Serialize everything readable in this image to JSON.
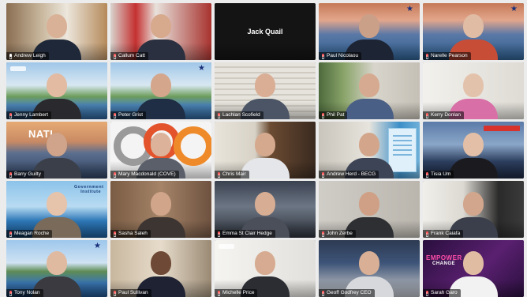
{
  "meeting": {
    "participants": [
      {
        "name": "Andrew Leigh",
        "bg": "bg-office",
        "skin": "#d9b197",
        "shirt": "#1f2838",
        "speaking": true,
        "muted": false
      },
      {
        "name": "Callum Catt",
        "bg": "bg-red",
        "skin": "#d7a98d",
        "shirt": "#2a3040",
        "speaking": false,
        "muted": true
      },
      {
        "name": "Jack Quail",
        "bg": "bg-black",
        "video_off": true,
        "speaking": false,
        "muted": true
      },
      {
        "name": "Paul Nicolaou",
        "bg": "bg-harbour",
        "skin": "#caa088",
        "shirt": "#1d2433",
        "speaking": false,
        "muted": true,
        "overlay": "star"
      },
      {
        "name": "Narelle Pearson",
        "bg": "bg-harbour",
        "skin": "#e0bca4",
        "shirt": "#c84d37",
        "speaking": false,
        "muted": true,
        "overlay": "star"
      },
      {
        "name": "Jenny Lambert",
        "bg": "bg-river",
        "skin": "#e2bba2",
        "shirt": "#2a2a2e",
        "speaking": false,
        "muted": true,
        "overlay": "logo"
      },
      {
        "name": "Peter Grist",
        "bg": "bg-river",
        "skin": "#d4a68c",
        "shirt": "#1f2e44",
        "speaking": false,
        "muted": true,
        "overlay": "star"
      },
      {
        "name": "Lachlan Scofield",
        "bg": "bg-blinds",
        "skin": "#d9ae95",
        "shirt": "#4b5566",
        "speaking": false,
        "muted": true
      },
      {
        "name": "Phil Pat",
        "bg": "bg-plant",
        "skin": "#d6aa90",
        "shirt": "#4a5f85",
        "speaking": false,
        "muted": true
      },
      {
        "name": "Kerry Donlan",
        "bg": "bg-white",
        "skin": "#e3c2ab",
        "shirt": "#d86fa6",
        "speaking": false,
        "muted": true
      },
      {
        "name": "Barry Guilty",
        "bg": "bg-city",
        "skin": "#cfa48a",
        "shirt": "#3b3f4a",
        "speaking": false,
        "muted": true,
        "overlay": "nat"
      },
      {
        "name": "Mary Macdonald (COVE)",
        "bg": "bg-logo",
        "skin": "#dcb39a",
        "shirt": "#5a5f6a",
        "speaking": false,
        "muted": true,
        "overlay": "rings"
      },
      {
        "name": "Chris Mair",
        "bg": "bg-books",
        "skin": "#d5a98e",
        "shirt": "#e4e6ea",
        "speaking": false,
        "muted": true
      },
      {
        "name": "Andrew Herd - BECG",
        "bg": "bg-office2",
        "skin": "#d3a68b",
        "shirt": "#3c4456",
        "speaking": false,
        "muted": true,
        "overlay": "panel"
      },
      {
        "name": "Tisia Um",
        "bg": "bg-hk",
        "skin": "#e2bfa6",
        "shirt": "#1b1b1f",
        "speaking": false,
        "muted": true,
        "overlay": "redtag"
      },
      {
        "name": "Meagan Roche",
        "bg": "bg-opera",
        "skin": "#e6c3ab",
        "shirt": "#7a6a5a",
        "speaking": false,
        "muted": true,
        "overlay": "gov"
      },
      {
        "name": "Sasha Saleh",
        "bg": "bg-wood",
        "skin": "#d0a58a",
        "shirt": "#3d3532",
        "speaking": false,
        "muted": true
      },
      {
        "name": "Emma St Clair Hedge",
        "bg": "bg-storm",
        "skin": "#d7ad93",
        "shirt": "#4a4f5a",
        "speaking": false,
        "muted": true
      },
      {
        "name": "John Zerbe",
        "bg": "bg-grey",
        "skin": "#cfa085",
        "shirt": "#2e2f33",
        "speaking": false,
        "muted": true
      },
      {
        "name": "Frank Caiafa",
        "bg": "bg-kitchen",
        "skin": "#d2a68c",
        "shirt": "#3a3f4b",
        "speaking": false,
        "muted": true
      },
      {
        "name": "Tony Nolan",
        "bg": "bg-lake",
        "skin": "#dfbaa1",
        "shirt": "#3a3a40",
        "speaking": false,
        "muted": true,
        "overlay": "star"
      },
      {
        "name": "Paul Sullivan",
        "bg": "bg-room",
        "skin": "#6e4a36",
        "shirt": "#1e2233",
        "speaking": false,
        "muted": true
      },
      {
        "name": "Michelle Price",
        "bg": "bg-wall",
        "skin": "#d6ab91",
        "shirt": "#2b2d33",
        "speaking": false,
        "muted": true,
        "overlay": "logo"
      },
      {
        "name": "Geoff Godfrey CEO",
        "bg": "bg-building",
        "skin": "#d9b096",
        "shirt": "#d6d8dc",
        "speaking": false,
        "muted": true
      },
      {
        "name": "Sarah Garo",
        "bg": "bg-purple",
        "skin": "#e0bca3",
        "shirt": "#f2f2f2",
        "speaking": false,
        "muted": true,
        "overlay": "empower"
      }
    ]
  },
  "overlays": {
    "nat": "NATI",
    "gov": "Government Institute",
    "empower": "EMPOWER",
    "empower2": "CHANGE"
  },
  "colors": {
    "speaking_border": "#38d26a",
    "muted_icon": "#ff5a5a"
  }
}
